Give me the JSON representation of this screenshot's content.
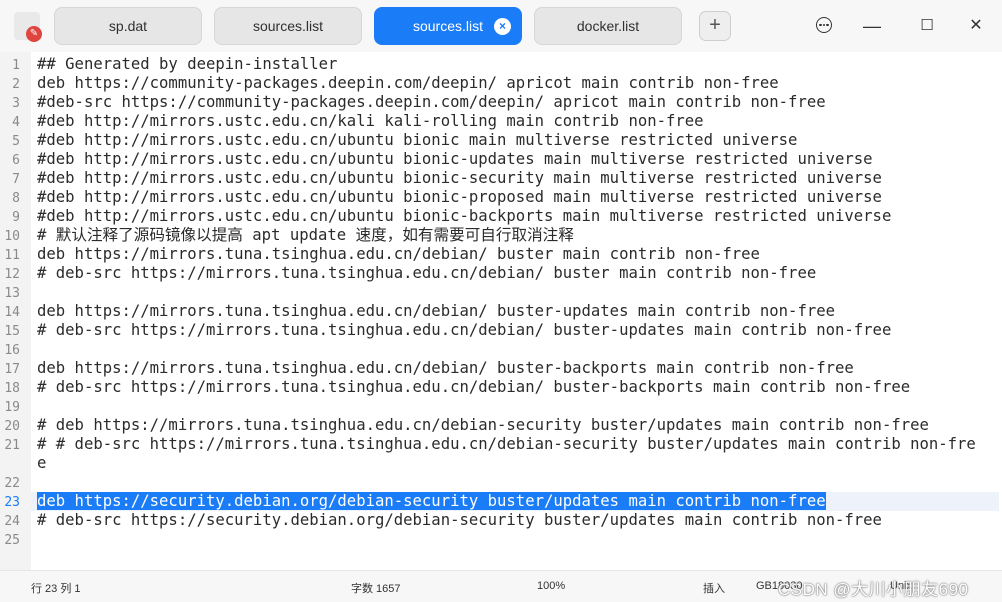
{
  "tabs": [
    {
      "label": "sp.dat",
      "active": false
    },
    {
      "label": "sources.list",
      "active": false
    },
    {
      "label": "sources.list",
      "active": true
    },
    {
      "label": "docker.list",
      "active": false
    }
  ],
  "tab_close_glyph": "×",
  "add_tab_glyph": "+",
  "window_controls": {
    "minimize": "—",
    "maximize": "☐",
    "close": "✕"
  },
  "lines": [
    {
      "num": "1",
      "text": "## Generated by deepin-installer"
    },
    {
      "num": "2",
      "text": "deb https://community-packages.deepin.com/deepin/ apricot main contrib non-free"
    },
    {
      "num": "3",
      "text": "#deb-src https://community-packages.deepin.com/deepin/ apricot main contrib non-free"
    },
    {
      "num": "4",
      "text": "#deb http://mirrors.ustc.edu.cn/kali kali-rolling main contrib non-free"
    },
    {
      "num": "5",
      "text": "#deb http://mirrors.ustc.edu.cn/ubuntu bionic main multiverse restricted universe"
    },
    {
      "num": "6",
      "text": "#deb http://mirrors.ustc.edu.cn/ubuntu bionic-updates main multiverse restricted universe"
    },
    {
      "num": "7",
      "text": "#deb http://mirrors.ustc.edu.cn/ubuntu bionic-security main multiverse restricted universe"
    },
    {
      "num": "8",
      "text": "#deb http://mirrors.ustc.edu.cn/ubuntu bionic-proposed main multiverse restricted universe"
    },
    {
      "num": "9",
      "text": "#deb http://mirrors.ustc.edu.cn/ubuntu bionic-backports main multiverse restricted universe"
    },
    {
      "num": "10",
      "text": "# 默认注释了源码镜像以提高 apt update 速度，如有需要可自行取消注释"
    },
    {
      "num": "11",
      "text": "deb https://mirrors.tuna.tsinghua.edu.cn/debian/ buster main contrib non-free"
    },
    {
      "num": "12",
      "text": "# deb-src https://mirrors.tuna.tsinghua.edu.cn/debian/ buster main contrib non-free"
    },
    {
      "num": "13",
      "text": ""
    },
    {
      "num": "14",
      "text": "deb https://mirrors.tuna.tsinghua.edu.cn/debian/ buster-updates main contrib non-free"
    },
    {
      "num": "15",
      "text": "# deb-src https://mirrors.tuna.tsinghua.edu.cn/debian/ buster-updates main contrib non-free"
    },
    {
      "num": "16",
      "text": ""
    },
    {
      "num": "17",
      "text": "deb https://mirrors.tuna.tsinghua.edu.cn/debian/ buster-backports main contrib non-free"
    },
    {
      "num": "18",
      "text": "# deb-src https://mirrors.tuna.tsinghua.edu.cn/debian/ buster-backports main contrib non-free"
    },
    {
      "num": "19",
      "text": ""
    },
    {
      "num": "20",
      "text": "# deb https://mirrors.tuna.tsinghua.edu.cn/debian-security buster/updates main contrib non-free"
    },
    {
      "num": "21",
      "text": "# # deb-src https://mirrors.tuna.tsinghua.edu.cn/debian-security buster/updates main contrib non-fre"
    },
    {
      "num": "",
      "text": "e"
    },
    {
      "num": "22",
      "text": ""
    },
    {
      "num": "23",
      "text": "deb https://security.debian.org/debian-security buster/updates main contrib non-free",
      "current": true
    },
    {
      "num": "24",
      "text": "# deb-src https://security.debian.org/debian-security buster/updates main contrib non-free"
    },
    {
      "num": "25",
      "text": ""
    }
  ],
  "status": {
    "position": "行 23  列 1",
    "char_count": "字数 1657",
    "zoom": "100%",
    "insert_mode": "插入",
    "encoding": "GB18030",
    "highlight": "Unix"
  },
  "watermark": "CSDN @大川小朋友690",
  "colors": {
    "accent": "#1a7cf6",
    "current_line": "#eef3fb",
    "gutter": "#f3f3f3"
  }
}
